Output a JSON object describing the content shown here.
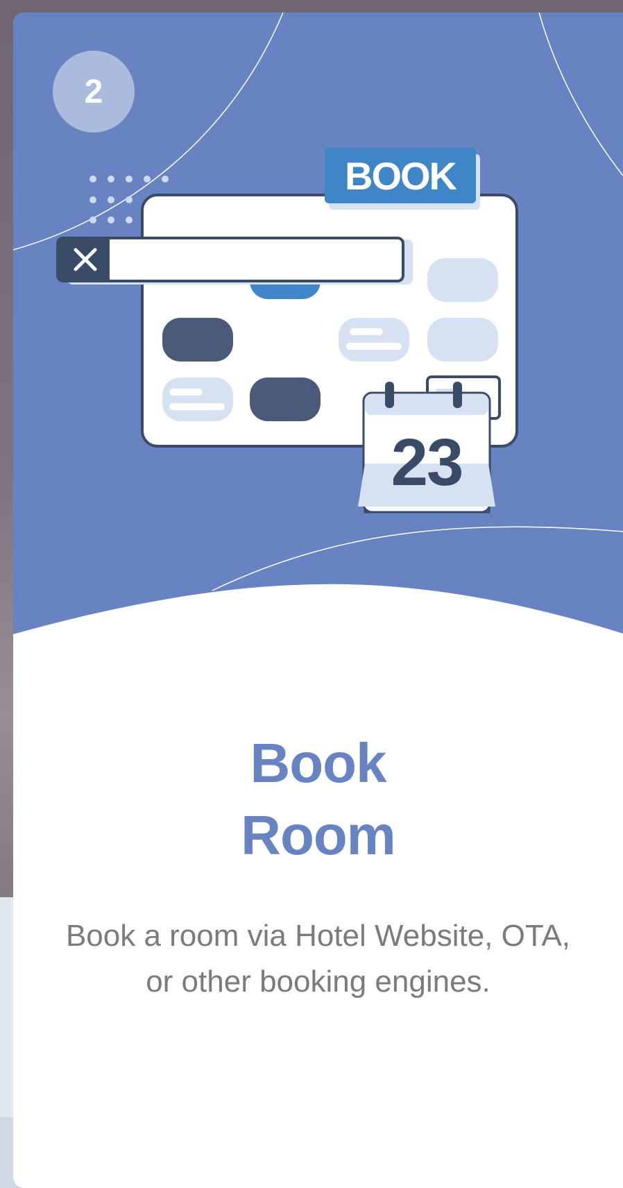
{
  "step": {
    "number": "2"
  },
  "card": {
    "title_line1": "Book",
    "title_line2": "Room",
    "description": "Book a room via Hotel Website, OTA, or other booking engines."
  },
  "illustration": {
    "book_label": "BOOK",
    "calendar_day": "23",
    "close_icon": "close-icon"
  },
  "colors": {
    "hero_blue": "#6783c2",
    "accent_blue": "#3f86c8",
    "navy": "#3a4b68",
    "light_blue": "#d6e1f2",
    "text_gray": "#7b7b7b"
  }
}
